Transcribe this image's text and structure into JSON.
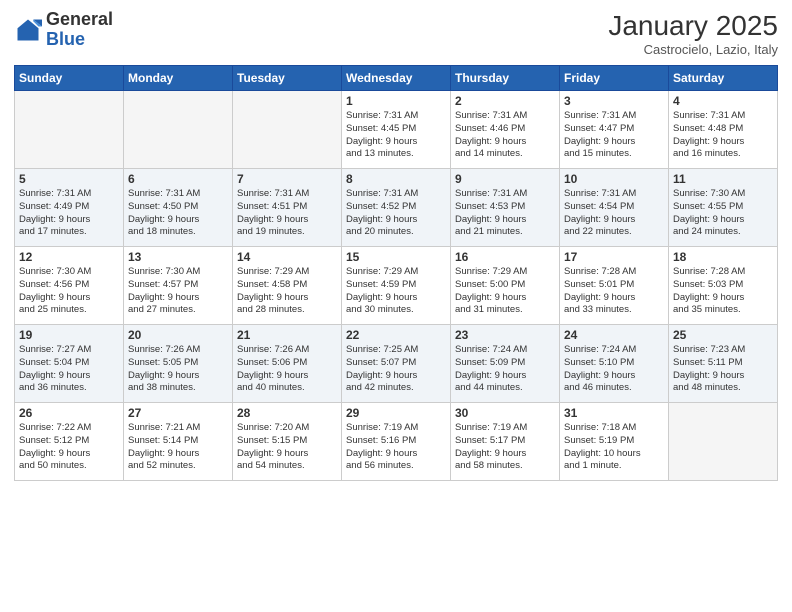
{
  "logo": {
    "general": "General",
    "blue": "Blue"
  },
  "header": {
    "month": "January 2025",
    "location": "Castrocielo, Lazio, Italy"
  },
  "weekdays": [
    "Sunday",
    "Monday",
    "Tuesday",
    "Wednesday",
    "Thursday",
    "Friday",
    "Saturday"
  ],
  "weeks": [
    [
      {
        "day": "",
        "info": ""
      },
      {
        "day": "",
        "info": ""
      },
      {
        "day": "",
        "info": ""
      },
      {
        "day": "1",
        "info": "Sunrise: 7:31 AM\nSunset: 4:45 PM\nDaylight: 9 hours\nand 13 minutes."
      },
      {
        "day": "2",
        "info": "Sunrise: 7:31 AM\nSunset: 4:46 PM\nDaylight: 9 hours\nand 14 minutes."
      },
      {
        "day": "3",
        "info": "Sunrise: 7:31 AM\nSunset: 4:47 PM\nDaylight: 9 hours\nand 15 minutes."
      },
      {
        "day": "4",
        "info": "Sunrise: 7:31 AM\nSunset: 4:48 PM\nDaylight: 9 hours\nand 16 minutes."
      }
    ],
    [
      {
        "day": "5",
        "info": "Sunrise: 7:31 AM\nSunset: 4:49 PM\nDaylight: 9 hours\nand 17 minutes."
      },
      {
        "day": "6",
        "info": "Sunrise: 7:31 AM\nSunset: 4:50 PM\nDaylight: 9 hours\nand 18 minutes."
      },
      {
        "day": "7",
        "info": "Sunrise: 7:31 AM\nSunset: 4:51 PM\nDaylight: 9 hours\nand 19 minutes."
      },
      {
        "day": "8",
        "info": "Sunrise: 7:31 AM\nSunset: 4:52 PM\nDaylight: 9 hours\nand 20 minutes."
      },
      {
        "day": "9",
        "info": "Sunrise: 7:31 AM\nSunset: 4:53 PM\nDaylight: 9 hours\nand 21 minutes."
      },
      {
        "day": "10",
        "info": "Sunrise: 7:31 AM\nSunset: 4:54 PM\nDaylight: 9 hours\nand 22 minutes."
      },
      {
        "day": "11",
        "info": "Sunrise: 7:30 AM\nSunset: 4:55 PM\nDaylight: 9 hours\nand 24 minutes."
      }
    ],
    [
      {
        "day": "12",
        "info": "Sunrise: 7:30 AM\nSunset: 4:56 PM\nDaylight: 9 hours\nand 25 minutes."
      },
      {
        "day": "13",
        "info": "Sunrise: 7:30 AM\nSunset: 4:57 PM\nDaylight: 9 hours\nand 27 minutes."
      },
      {
        "day": "14",
        "info": "Sunrise: 7:29 AM\nSunset: 4:58 PM\nDaylight: 9 hours\nand 28 minutes."
      },
      {
        "day": "15",
        "info": "Sunrise: 7:29 AM\nSunset: 4:59 PM\nDaylight: 9 hours\nand 30 minutes."
      },
      {
        "day": "16",
        "info": "Sunrise: 7:29 AM\nSunset: 5:00 PM\nDaylight: 9 hours\nand 31 minutes."
      },
      {
        "day": "17",
        "info": "Sunrise: 7:28 AM\nSunset: 5:01 PM\nDaylight: 9 hours\nand 33 minutes."
      },
      {
        "day": "18",
        "info": "Sunrise: 7:28 AM\nSunset: 5:03 PM\nDaylight: 9 hours\nand 35 minutes."
      }
    ],
    [
      {
        "day": "19",
        "info": "Sunrise: 7:27 AM\nSunset: 5:04 PM\nDaylight: 9 hours\nand 36 minutes."
      },
      {
        "day": "20",
        "info": "Sunrise: 7:26 AM\nSunset: 5:05 PM\nDaylight: 9 hours\nand 38 minutes."
      },
      {
        "day": "21",
        "info": "Sunrise: 7:26 AM\nSunset: 5:06 PM\nDaylight: 9 hours\nand 40 minutes."
      },
      {
        "day": "22",
        "info": "Sunrise: 7:25 AM\nSunset: 5:07 PM\nDaylight: 9 hours\nand 42 minutes."
      },
      {
        "day": "23",
        "info": "Sunrise: 7:24 AM\nSunset: 5:09 PM\nDaylight: 9 hours\nand 44 minutes."
      },
      {
        "day": "24",
        "info": "Sunrise: 7:24 AM\nSunset: 5:10 PM\nDaylight: 9 hours\nand 46 minutes."
      },
      {
        "day": "25",
        "info": "Sunrise: 7:23 AM\nSunset: 5:11 PM\nDaylight: 9 hours\nand 48 minutes."
      }
    ],
    [
      {
        "day": "26",
        "info": "Sunrise: 7:22 AM\nSunset: 5:12 PM\nDaylight: 9 hours\nand 50 minutes."
      },
      {
        "day": "27",
        "info": "Sunrise: 7:21 AM\nSunset: 5:14 PM\nDaylight: 9 hours\nand 52 minutes."
      },
      {
        "day": "28",
        "info": "Sunrise: 7:20 AM\nSunset: 5:15 PM\nDaylight: 9 hours\nand 54 minutes."
      },
      {
        "day": "29",
        "info": "Sunrise: 7:19 AM\nSunset: 5:16 PM\nDaylight: 9 hours\nand 56 minutes."
      },
      {
        "day": "30",
        "info": "Sunrise: 7:19 AM\nSunset: 5:17 PM\nDaylight: 9 hours\nand 58 minutes."
      },
      {
        "day": "31",
        "info": "Sunrise: 7:18 AM\nSunset: 5:19 PM\nDaylight: 10 hours\nand 1 minute."
      },
      {
        "day": "",
        "info": ""
      }
    ]
  ]
}
